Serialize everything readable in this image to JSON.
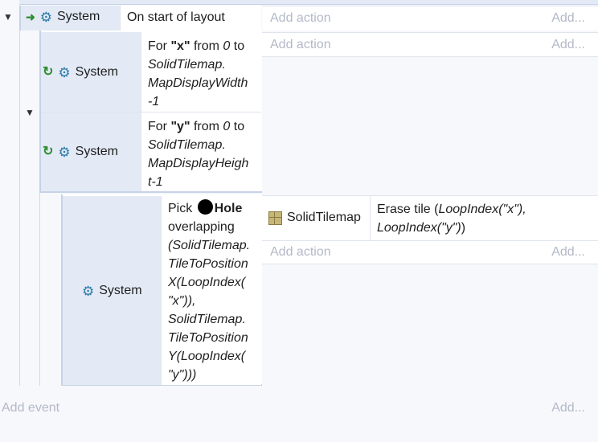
{
  "system_label": "System",
  "event1": {
    "condition": "On start of layout",
    "add_action": "Add action",
    "add_short": "Add..."
  },
  "event2": {
    "for_prefix": "For ",
    "for_var": "\"x\"",
    "for_from": " from ",
    "for_zero": "0",
    "for_to": " to",
    "expr_lines": [
      "SolidTilemap.",
      "MapDisplayWidth",
      "-1"
    ],
    "add_action": "Add action",
    "add_short": "Add..."
  },
  "event3": {
    "for_prefix": "For ",
    "for_var": "\"y\"",
    "for_from": " from ",
    "for_zero": "0",
    "for_to": " to",
    "expr_lines": [
      "SolidTilemap.",
      "MapDisplayHeigh",
      "t-1"
    ]
  },
  "event4": {
    "pick_word": "Pick ",
    "hole_name": "Hole",
    "lines": [
      "overlapping",
      "(SolidTilemap.",
      "TileToPosition",
      "X(LoopIndex(",
      "\"x\")),",
      "SolidTilemap.",
      "TileToPosition",
      "Y(LoopIndex(",
      "\"y\")))"
    ],
    "action_object": "SolidTilemap",
    "action_text_1": "Erase tile (",
    "action_param_1": "LoopIndex(\"x\"),",
    "action_param_2": "LoopIndex(\"y\")",
    "action_close": ")",
    "add_action": "Add action",
    "add_short": "Add..."
  },
  "footer": {
    "add_event": "Add event",
    "add_short": "Add..."
  },
  "colors": {
    "system_icon": "#2e7ba8",
    "loop_icon": "#2e8c2e",
    "trigger_arrow": "#2e8c2e",
    "placeholder": "#b3b9c8"
  },
  "icons": {
    "collapse": "triangle-down-icon",
    "system": "gear-icon",
    "loop": "loop-icon",
    "trigger": "trigger-arrow-icon",
    "tilemap": "tilemap-icon"
  }
}
